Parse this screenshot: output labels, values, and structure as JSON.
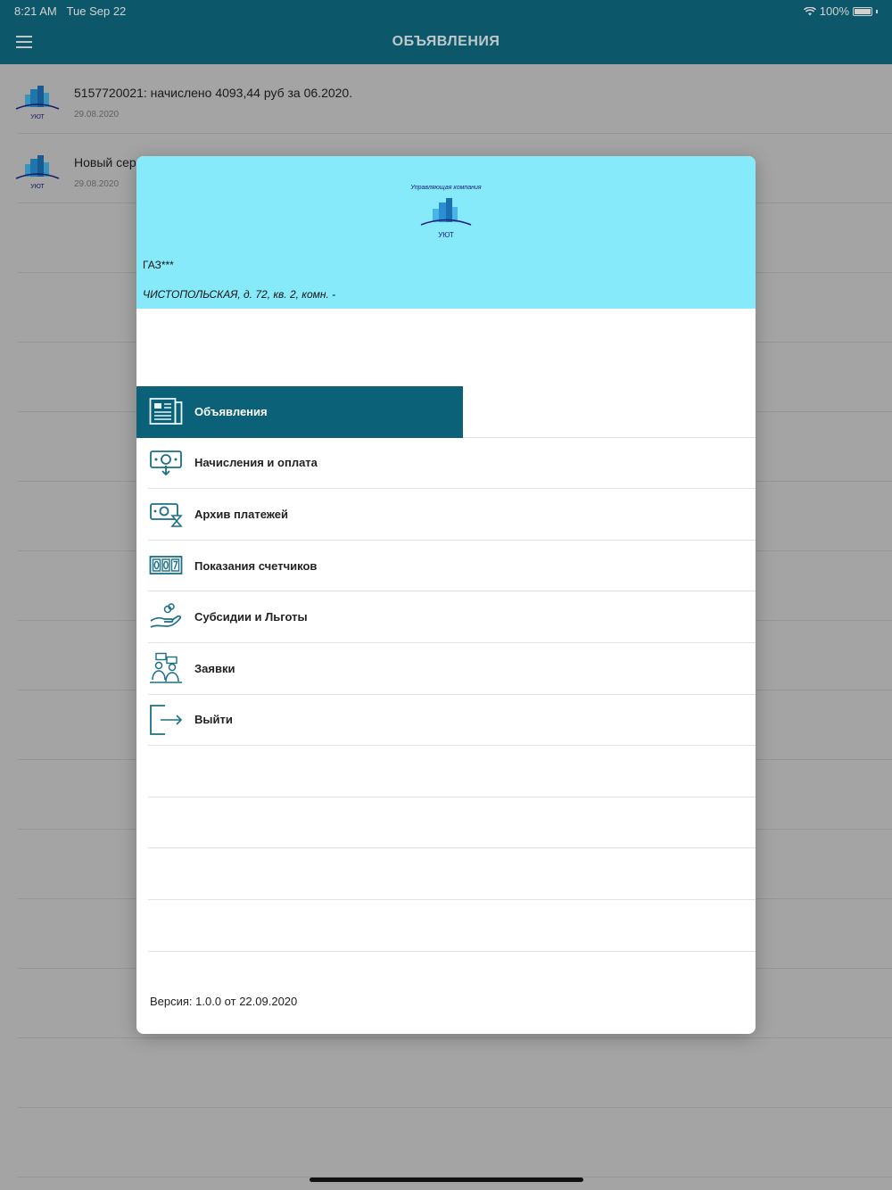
{
  "status": {
    "time": "8:21 AM",
    "date": "Tue Sep 22",
    "battery": "100%"
  },
  "nav": {
    "title": "ОБЪЯВЛЕНИЯ",
    "menu_icon": "hamburger-icon"
  },
  "list": {
    "items": [
      {
        "title": "5157720021: начислено 4093,44 руб за 06.2020.",
        "date": "29.08.2020",
        "logo_label": "УЮТ"
      },
      {
        "title": "Новый сер",
        "date": "29.08.2020",
        "logo_label": "УЮТ"
      }
    ]
  },
  "drawer": {
    "company_caption": "Управляющая компания",
    "logo_label": "УЮТ",
    "user_name": "ГАЗ***",
    "address": "ЧИСТОПОЛЬСКАЯ, д. 72, кв. 2, комн. -",
    "menu": [
      {
        "label": "Объявления",
        "icon": "newspaper-icon",
        "active": true
      },
      {
        "label": "Начисления и оплата",
        "icon": "money-icon"
      },
      {
        "label": "Архив платежей",
        "icon": "archive-payments-icon"
      },
      {
        "label": "Показания счетчиков",
        "icon": "meter-icon"
      },
      {
        "label": "Субсидии и Льготы",
        "icon": "subsidy-hand-icon"
      },
      {
        "label": "Заявки",
        "icon": "requests-icon"
      },
      {
        "label": "Выйти",
        "icon": "logout-icon"
      }
    ],
    "version": "Версия: 1.0.0 от 22.09.2020"
  },
  "colors": {
    "primary": "#0f6b80",
    "active": "#0b6177",
    "header_bg": "#86eafa",
    "icon": "#1b6f86"
  }
}
